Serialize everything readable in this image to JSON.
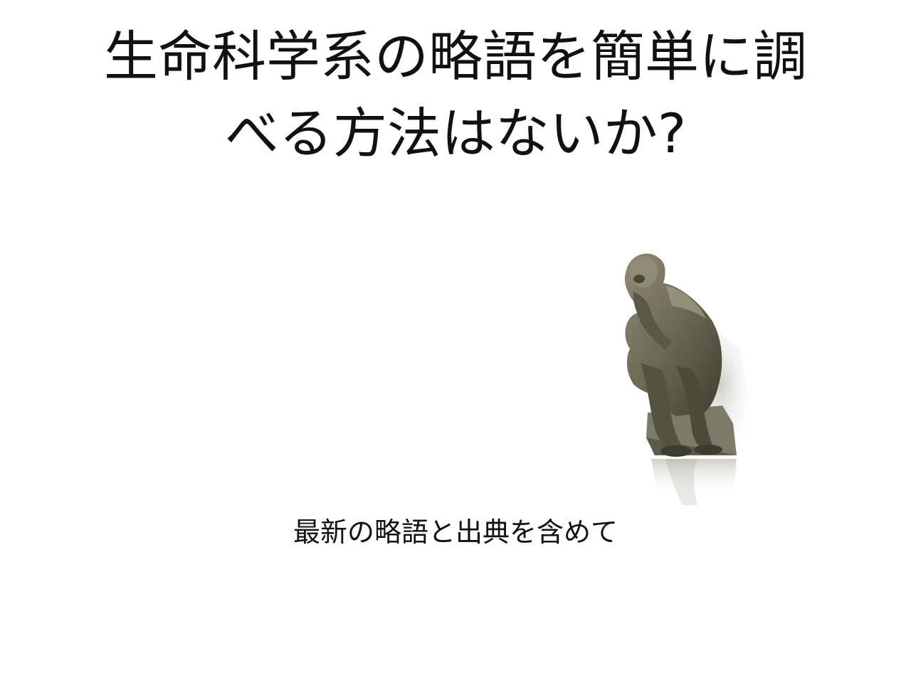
{
  "slide": {
    "title_line1": "生命科学系の略語を簡単に調",
    "title_line2": "べる方法はないか?",
    "subtitle": "最新の略語と出典を含めて"
  },
  "illustration": {
    "icon": "thinker-statue-icon",
    "colors": {
      "bronze_dark": "#4a4a3a",
      "bronze_mid": "#7a7864",
      "bronze_light": "#a8a48e",
      "shadow": "#d9d7cf"
    }
  }
}
